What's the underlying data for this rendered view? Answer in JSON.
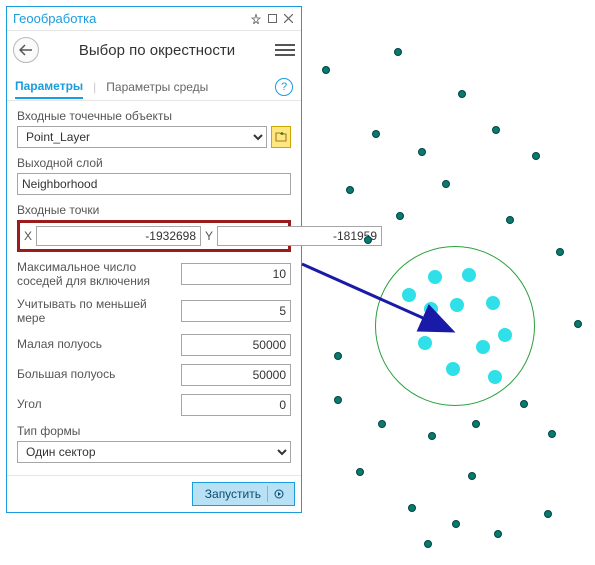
{
  "panel": {
    "title": "Геообработка",
    "tool_title": "Выбор по окрестности"
  },
  "tabs": {
    "params": "Параметры",
    "env": "Параметры среды"
  },
  "fields": {
    "input_points_label": "Входные точечные объекты",
    "input_points_value": "Point_Layer",
    "output_layer_label": "Выходной слой",
    "output_layer_value": "Neighborhood",
    "input_xy_label": "Входные точки",
    "x_label": "X",
    "x_value": "-1932698",
    "y_label": "Y",
    "y_value": "-181959",
    "max_neighbors_label": "Максимальное число соседей для включения",
    "max_neighbors_value": "10",
    "min_include_label": "Учитывать по меньшей мере",
    "min_include_value": "5",
    "minor_axis_label": "Малая полуось",
    "minor_axis_value": "50000",
    "major_axis_label": "Большая полуось",
    "major_axis_value": "50000",
    "angle_label": "Угол",
    "angle_value": "0",
    "shape_type_label": "Тип формы",
    "shape_type_value": "Один сектор"
  },
  "run": {
    "label": "Запустить"
  }
}
